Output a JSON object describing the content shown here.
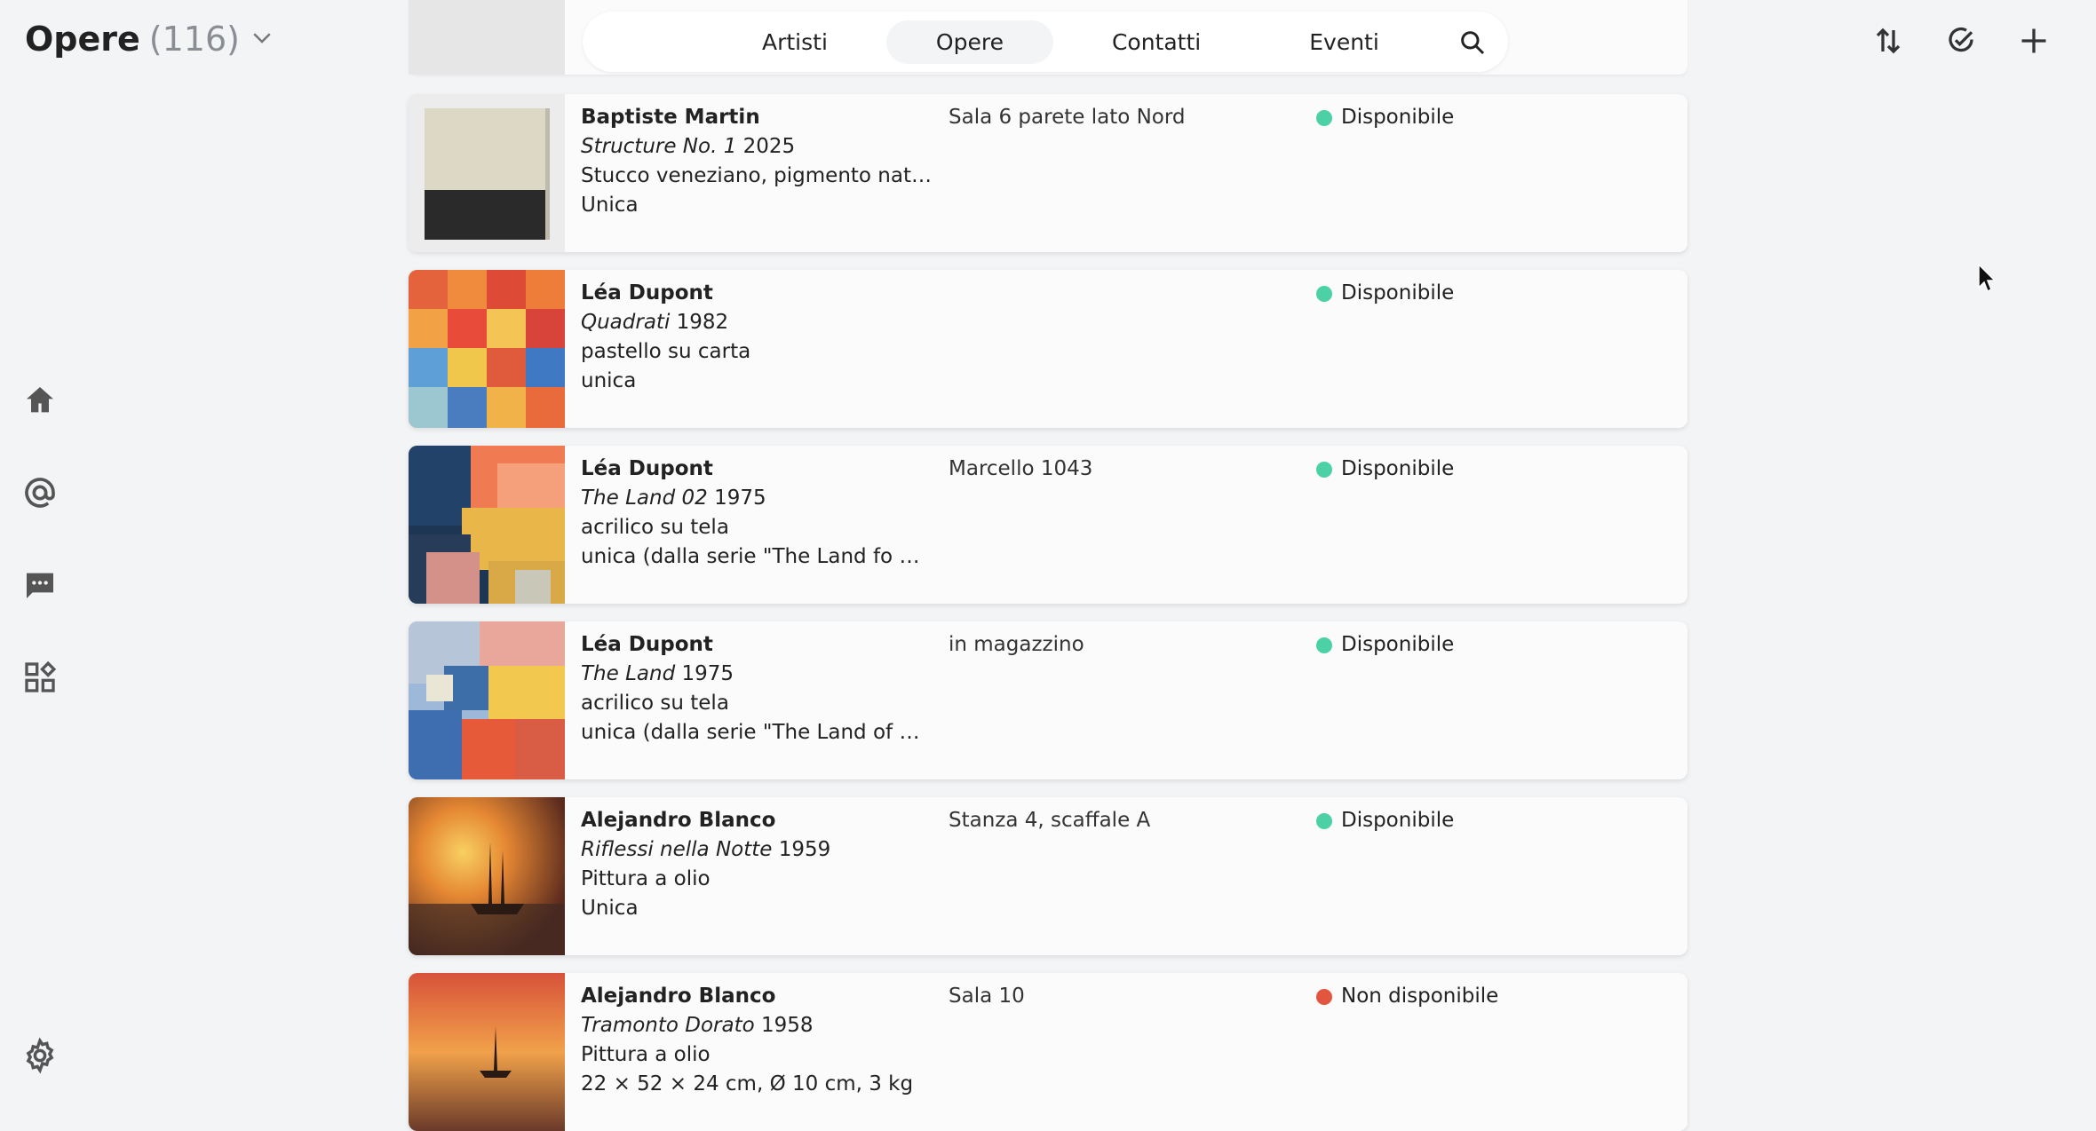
{
  "header": {
    "title": "Opere",
    "count": "(116)"
  },
  "tabs": [
    {
      "label": "Artisti",
      "active": false
    },
    {
      "label": "Opere",
      "active": true
    },
    {
      "label": "Contatti",
      "active": false
    },
    {
      "label": "Eventi",
      "active": false
    }
  ],
  "icons": {
    "search": "search-icon",
    "sort": "sort-icon",
    "check": "check-circle-icon",
    "add": "plus-icon",
    "home": "home-icon",
    "at": "at-icon",
    "chat": "chat-icon",
    "apps": "apps-icon",
    "settings": "gear-icon"
  },
  "colors": {
    "available": "#4cd1a6",
    "unavailable": "#e2553f"
  },
  "artworks": [
    {
      "artist": "Baptiste Martin",
      "title": "Structure No. 1",
      "year": "2025",
      "medium": "Stucco veneziano, pigmento natural...",
      "edition": "Unica",
      "location": "Sala 6 parete lato Nord",
      "status": "Disponibile",
      "available": true
    },
    {
      "artist": "Léa Dupont",
      "title": "Quadrati",
      "year": "1982",
      "medium": "pastello su carta",
      "edition": "unica",
      "location": "",
      "status": "Disponibile",
      "available": true
    },
    {
      "artist": "Léa Dupont",
      "title": "The Land 02",
      "year": "1975",
      "medium": "acrilico su tela",
      "edition": "unica (dalla serie \"The Land fo my Li...",
      "location": "Marcello 1043",
      "status": "Disponibile",
      "available": true
    },
    {
      "artist": "Léa Dupont",
      "title": "The Land",
      "year": "1975",
      "medium": "acrilico su tela",
      "edition": "unica (dalla serie \"The Land of my Li...",
      "location": "in magazzino",
      "status": "Disponibile",
      "available": true
    },
    {
      "artist": "Alejandro Blanco",
      "title": "Riflessi nella Notte",
      "year": "1959",
      "medium": "Pittura a olio",
      "edition": "Unica",
      "location": "Stanza 4, scaffale A",
      "status": "Disponibile",
      "available": true
    },
    {
      "artist": "Alejandro Blanco",
      "title": "Tramonto Dorato",
      "year": "1958",
      "medium": "Pittura a olio",
      "edition": "22 × 52 × 24 cm, Ø 10 cm, 3 kg",
      "location": "Sala 10",
      "status": "Non disponibile",
      "available": false
    }
  ]
}
